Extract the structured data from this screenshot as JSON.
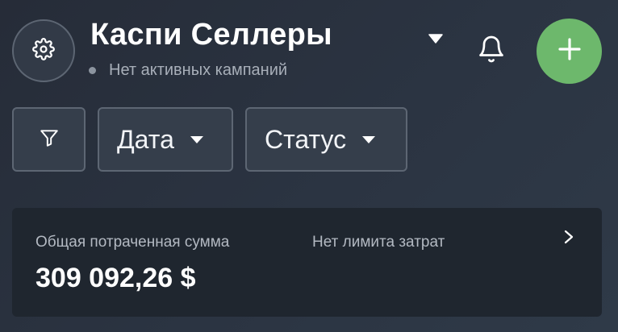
{
  "header": {
    "title": "Каспи Селлеры",
    "status_text": "Нет активных кампаний",
    "icons": {
      "settings": "gear-icon",
      "dropdown": "caret-down-icon",
      "notifications": "bell-icon",
      "add": "plus-icon"
    }
  },
  "filters": {
    "filter_icon": "filter-icon",
    "date_label": "Дата",
    "status_label": "Статус"
  },
  "spend_card": {
    "total_label": "Общая потраченная сумма",
    "total_value": "309 092,26 $",
    "limit_text": "Нет лимита затрат",
    "chevron_icon": "chevron-right-icon"
  },
  "colors": {
    "accent_green": "#6db86c",
    "card_background": "#1f262f",
    "chip_background": "#353e4b"
  }
}
